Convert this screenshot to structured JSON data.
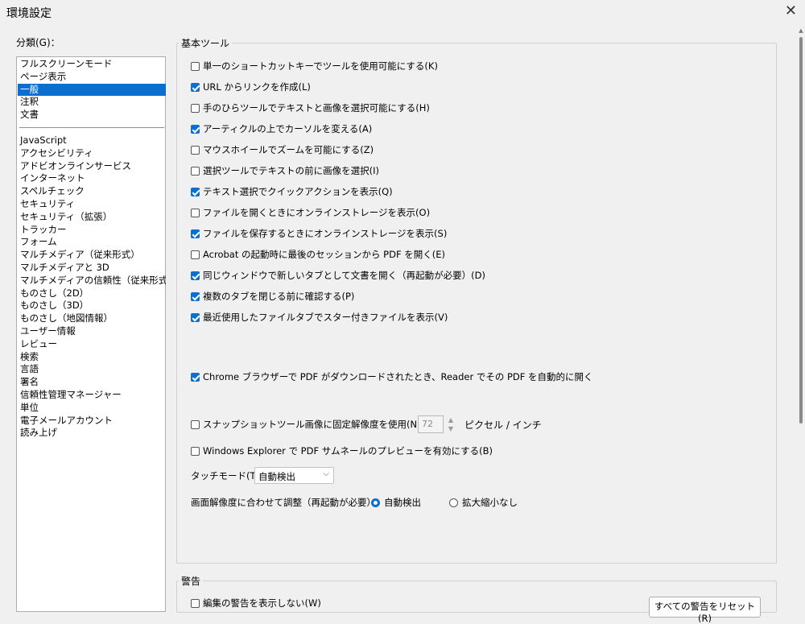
{
  "window": {
    "title": "環境設定",
    "close_icon": "close-icon"
  },
  "categories": {
    "label": "分類(G)：",
    "top_items": [
      "フルスクリーンモード",
      "ページ表示",
      "一般",
      "注釈",
      "文書"
    ],
    "selected": "一般",
    "items": [
      "JavaScript",
      "アクセシビリティ",
      "アドビオンラインサービス",
      "インターネット",
      "スペルチェック",
      "セキュリティ",
      "セキュリティ（拡張）",
      "トラッカー",
      "フォーム",
      "マルチメディア（従来形式）",
      "マルチメディアと 3D",
      "マルチメディアの信頼性（従来形式）",
      "ものさし（2D）",
      "ものさし（3D）",
      "ものさし（地図情報）",
      "ユーザー情報",
      "レビュー",
      "検索",
      "言語",
      "署名",
      "信頼性管理マネージャー",
      "単位",
      "電子メールアカウント",
      "読み上げ"
    ]
  },
  "basic_tools": {
    "title": "基本ツール",
    "options": [
      {
        "label": "単一のショートカットキーでツールを使用可能にする(K)",
        "checked": false
      },
      {
        "label": "URL からリンクを作成(L)",
        "checked": true
      },
      {
        "label": "手のひらツールでテキストと画像を選択可能にする(H)",
        "checked": false
      },
      {
        "label": "アーティクルの上でカーソルを変える(A)",
        "checked": true
      },
      {
        "label": "マウスホイールでズームを可能にする(Z)",
        "checked": false
      },
      {
        "label": "選択ツールでテキストの前に画像を選択(I)",
        "checked": false
      },
      {
        "label": "テキスト選択でクイックアクションを表示(Q)",
        "checked": true
      },
      {
        "label": "ファイルを開くときにオンラインストレージを表示(O)",
        "checked": false
      },
      {
        "label": "ファイルを保存するときにオンラインストレージを表示(S)",
        "checked": true
      },
      {
        "label": "Acrobat の起動時に最後のセッションから PDF を開く(E)",
        "checked": false
      },
      {
        "label": "同じウィンドウで新しいタブとして文書を開く（再起動が必要）(D)",
        "checked": true
      },
      {
        "label": "複数のタブを閉じる前に確認する(P)",
        "checked": true
      },
      {
        "label": "最近使用したファイルタブでスター付きファイルを表示(V)",
        "checked": true
      }
    ],
    "chrome_option": {
      "label": "Chrome ブラウザーで PDF がダウンロードされたとき、Reader でその PDF を自動的に開く",
      "checked": true
    },
    "snapshot": {
      "label": "スナップショットツール画像に固定解像度を使用(N)：",
      "checked": false,
      "value": "72",
      "unit": "ピクセル / インチ"
    },
    "explorer": {
      "label": "Windows Explorer で PDF サムネールのプレビューを有効にする(B)",
      "checked": false
    },
    "touch_mode": {
      "label": "タッチモード(T)：",
      "value": "自動検出"
    },
    "resolution": {
      "label": "画面解像度に合わせて調整（再起動が必要）：",
      "options": [
        "自動検出",
        "拡大縮小なし"
      ],
      "selected": "自動検出"
    }
  },
  "warnings": {
    "title": "警告",
    "option": {
      "label": "編集の警告を表示しない(W)",
      "checked": false
    },
    "reset_button": "すべての警告をリセット(R)"
  },
  "colors": {
    "accent": "#0b6fd0",
    "background": "#f0f0f0",
    "separator": "#5b9bd5"
  }
}
